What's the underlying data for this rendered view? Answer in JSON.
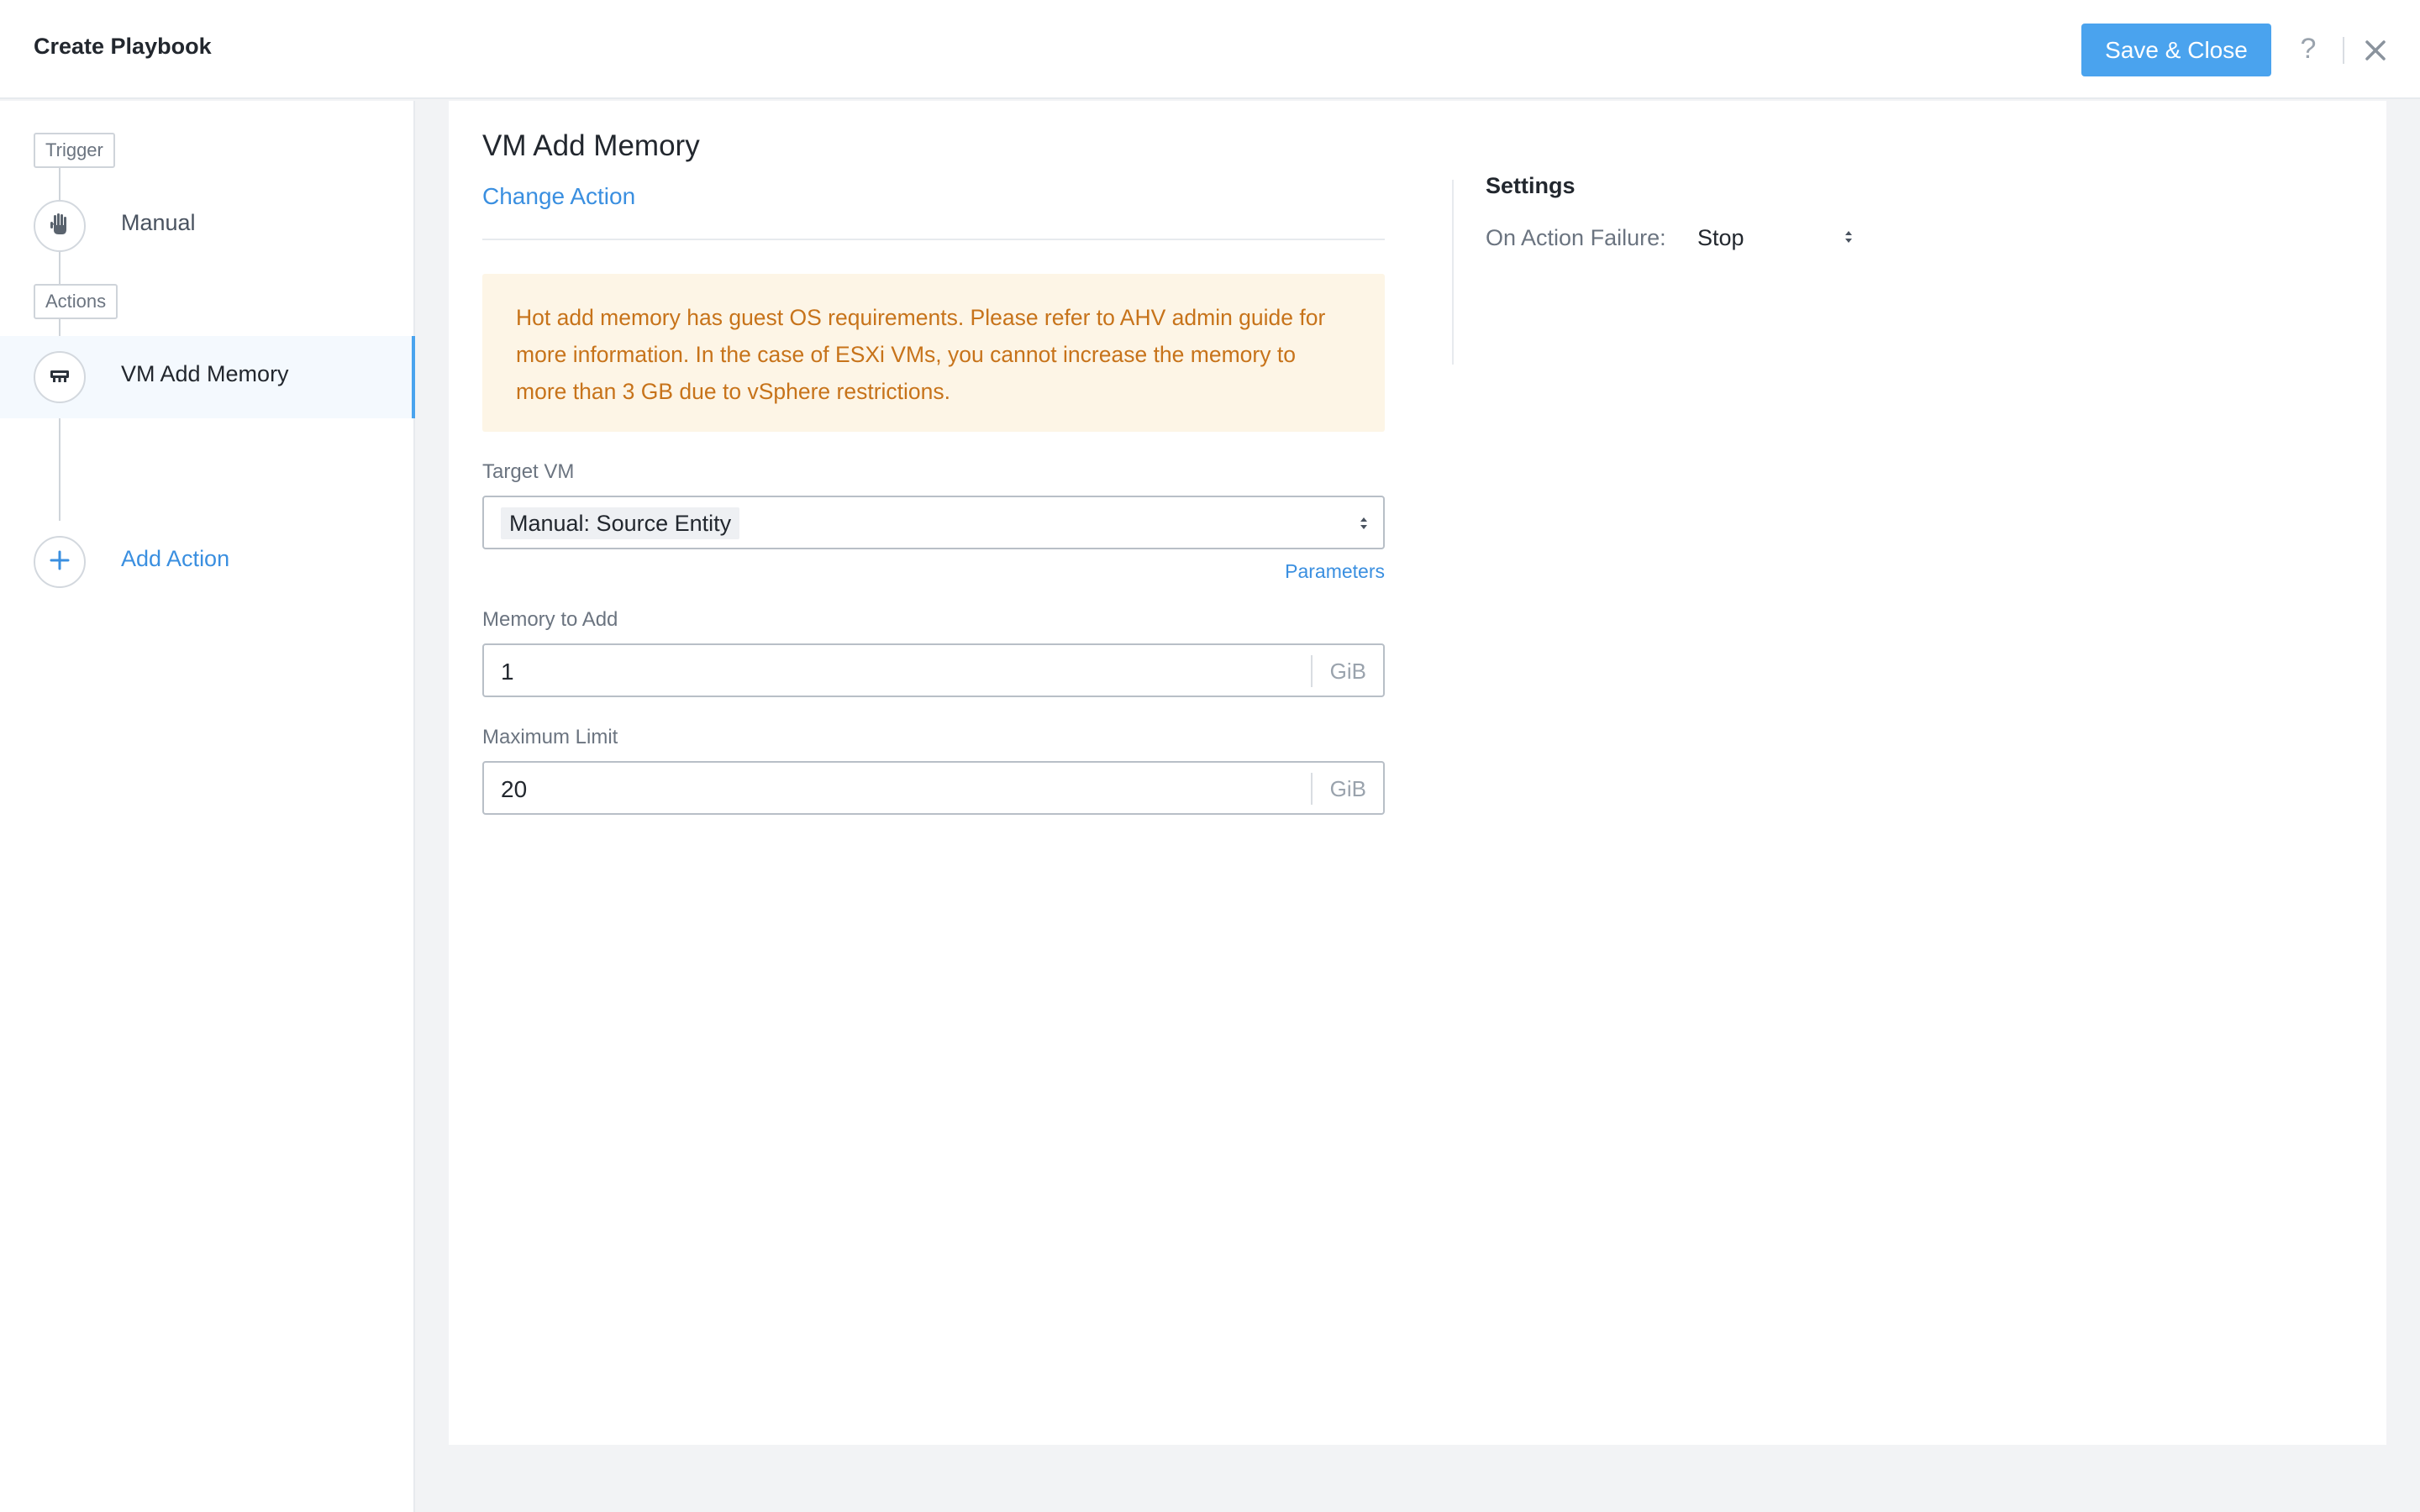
{
  "header": {
    "title": "Create Playbook",
    "save_label": "Save & Close",
    "help_label": "?"
  },
  "sidebar": {
    "trigger_tag": "Trigger",
    "trigger_step": {
      "label": "Manual",
      "icon": "hand-icon"
    },
    "actions_tag": "Actions",
    "action_step": {
      "label": "VM Add Memory",
      "icon": "memory-icon",
      "active": true
    },
    "add_action": {
      "label": "Add Action",
      "icon": "plus-icon"
    }
  },
  "main": {
    "action_title": "VM Add Memory",
    "change_action": "Change Action",
    "warning": "Hot add memory has guest OS requirements. Please refer to AHV admin guide for more information. In the case of ESXi VMs, you cannot increase the memory to more than 3 GB due to vSphere restrictions.",
    "target_vm": {
      "label": "Target VM",
      "value": "Manual: Source Entity"
    },
    "parameters_link": "Parameters",
    "memory_to_add": {
      "label": "Memory to Add",
      "value": "1",
      "unit": "GiB"
    },
    "maximum_limit": {
      "label": "Maximum Limit",
      "value": "20",
      "unit": "GiB"
    }
  },
  "settings": {
    "title": "Settings",
    "on_action_failure_label": "On Action Failure:",
    "on_action_failure_value": "Stop"
  },
  "colors": {
    "accent": "#4aa3ee",
    "link": "#3a8fe0",
    "warning_bg": "#fdf5e6",
    "warning_text": "#c7731a"
  }
}
